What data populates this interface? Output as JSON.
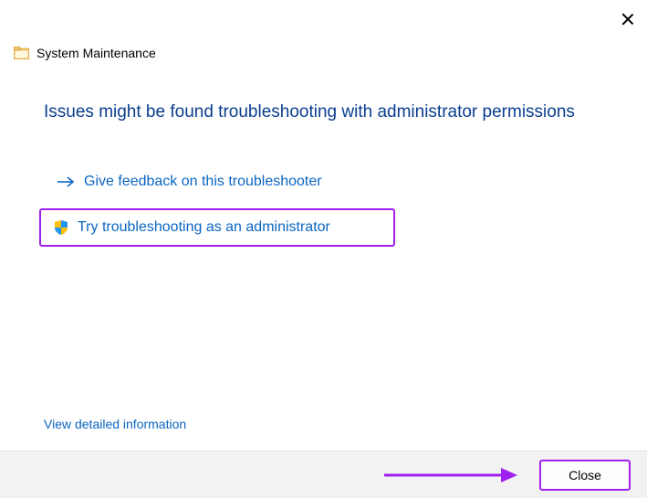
{
  "header": {
    "title": "System Maintenance"
  },
  "main": {
    "heading": "Issues might be found troubleshooting with administrator permissions",
    "feedback_link": "Give feedback on this troubleshooter",
    "admin_link": "Try troubleshooting as an administrator",
    "detail_link": "View detailed information"
  },
  "footer": {
    "close_label": "Close"
  }
}
